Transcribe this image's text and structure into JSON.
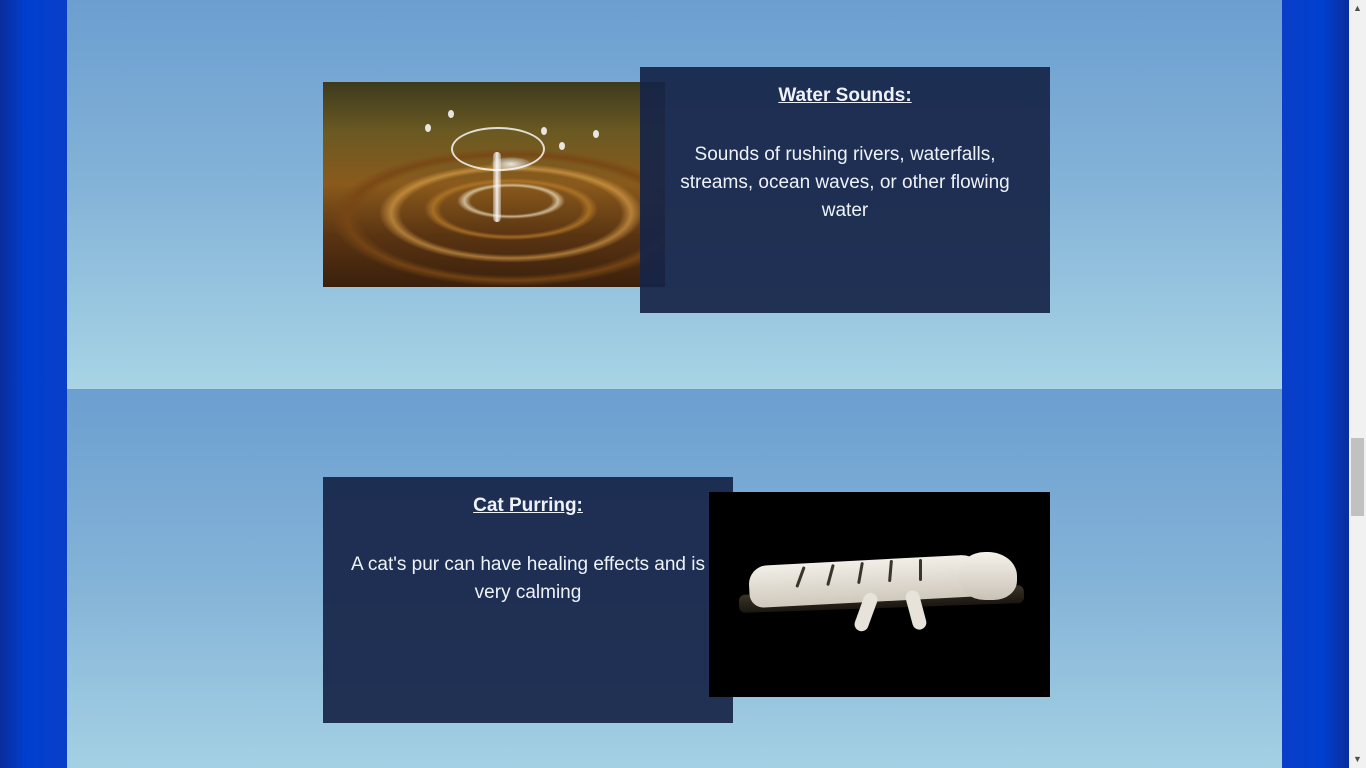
{
  "sections": [
    {
      "title": "Water Sounds:",
      "description": "Sounds of rushing rivers, waterfalls, streams, ocean waves, or other flowing water",
      "image_icon": "water-drop-image"
    },
    {
      "title": "Cat Purring:",
      "description": "A cat's pur can have healing effects and is very calming",
      "image_icon": "white-tiger-image"
    }
  ],
  "scrollbar": {
    "up_arrow": "▲",
    "down_arrow": "▼"
  },
  "colors": {
    "side_background": "#0039c6",
    "card_background": "#1c2c4e",
    "section_top": "#6c9fd0",
    "section_bottom": "#a8d4e5"
  }
}
